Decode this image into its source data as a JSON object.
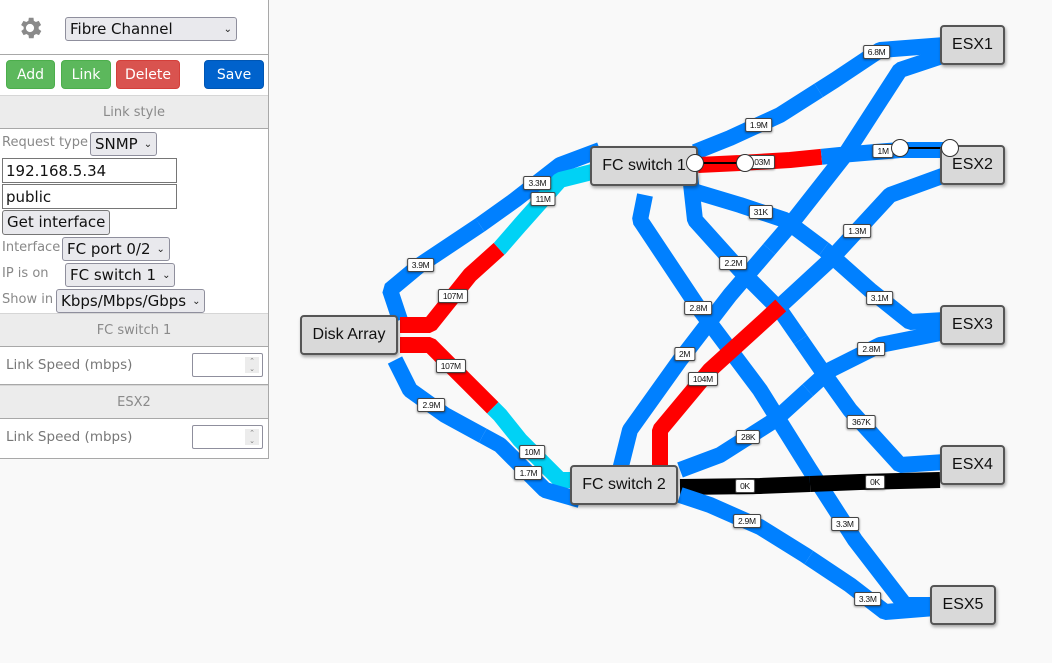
{
  "panel": {
    "settings_icon": "gear-icon",
    "network_type": "Fibre Channel",
    "buttons": {
      "add": "Add",
      "link": "Link",
      "delete": "Delete",
      "save": "Save"
    },
    "link_style_header": "Link style",
    "request_type_label": "Request type",
    "request_type": "SNMP",
    "ip_address": "192.168.5.34",
    "community": "public",
    "get_interface_label": "Get interface",
    "interface_label": "Interface",
    "interface": "FC port 0/2",
    "ip_is_on_label": "IP is on",
    "ip_is_on": "FC switch 1",
    "show_in_label": "Show in",
    "show_in": "Kbps/Mbps/Gbps",
    "sections": [
      {
        "title": "FC switch 1",
        "field_label": "Link Speed (mbps)",
        "value": ""
      },
      {
        "title": "ESX2",
        "field_label": "Link Speed (mbps)",
        "value": ""
      }
    ]
  },
  "colors": {
    "low": "#0080ff",
    "medium": "#00d2f5",
    "high": "#ff0000",
    "zero": "#000000",
    "node_fill": "#d9d9d9"
  },
  "nodes": [
    {
      "id": "disk",
      "label": "Disk Array"
    },
    {
      "id": "fc1",
      "label": "FC switch 1"
    },
    {
      "id": "fc2",
      "label": "FC switch 2"
    },
    {
      "id": "esx1",
      "label": "ESX1"
    },
    {
      "id": "esx2",
      "label": "ESX2"
    },
    {
      "id": "esx3",
      "label": "ESX3"
    },
    {
      "id": "esx4",
      "label": "ESX4"
    },
    {
      "id": "esx5",
      "label": "ESX5"
    }
  ],
  "links": [
    {
      "from": "disk",
      "to": "fc1",
      "a_label": "3.9M",
      "a_level": "low",
      "b_label": "3.3M",
      "b_level": "low"
    },
    {
      "from": "disk",
      "to": "fc1",
      "a_label": "107M",
      "a_level": "high",
      "b_label": "11M",
      "b_level": "medium"
    },
    {
      "from": "disk",
      "to": "fc2",
      "a_label": "107M",
      "a_level": "high",
      "b_label": "10M",
      "b_level": "medium"
    },
    {
      "from": "disk",
      "to": "fc2",
      "a_label": "2.9M",
      "a_level": "low",
      "b_label": "1.7M",
      "b_level": "low"
    },
    {
      "from": "fc1",
      "to": "esx1",
      "a_label": "1.9M",
      "a_level": "low",
      "b_label": "6.8M",
      "b_level": "low"
    },
    {
      "from": "fc1",
      "to": "esx2",
      "a_label": "103M",
      "a_level": "high",
      "b_label": "1M",
      "b_level": "low",
      "selected": true
    },
    {
      "from": "fc1",
      "to": "esx3",
      "a_label": "31K",
      "a_level": "low",
      "b_label": "3.1M",
      "b_level": "low"
    },
    {
      "from": "fc1",
      "to": "esx4",
      "a_label": "2.2M",
      "a_level": "low",
      "b_label": "367K",
      "b_level": "low"
    },
    {
      "from": "fc1",
      "to": "esx5",
      "a_label": "2.8M",
      "a_level": "low",
      "b_label": "3.3M",
      "b_level": "low"
    },
    {
      "from": "fc2",
      "to": "esx1",
      "a_label": "2M",
      "a_level": "low",
      "b_label": "",
      "b_level": "low"
    },
    {
      "from": "fc2",
      "to": "esx2",
      "a_label": "104M",
      "a_level": "high",
      "b_label": "1.3M",
      "b_level": "low"
    },
    {
      "from": "fc2",
      "to": "esx3",
      "a_label": "28K",
      "a_level": "low",
      "b_label": "2.8M",
      "b_level": "low"
    },
    {
      "from": "fc2",
      "to": "esx4",
      "a_label": "0K",
      "a_level": "zero",
      "b_label": "0K",
      "b_level": "zero"
    },
    {
      "from": "fc2",
      "to": "esx5",
      "a_label": "2.9M",
      "a_level": "low",
      "b_label": "3.3M",
      "b_level": "low"
    }
  ]
}
